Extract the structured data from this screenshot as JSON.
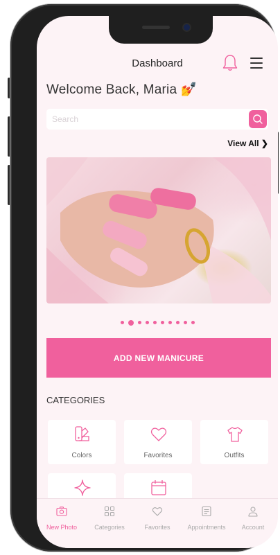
{
  "header": {
    "title": "Dashboard"
  },
  "welcome": {
    "text": "Welcome Back, Maria",
    "emoji": "💅"
  },
  "search": {
    "placeholder": "Search"
  },
  "featured": {
    "view_all": "View All ❯",
    "slide_count": 10,
    "active_slide": 2
  },
  "actions": {
    "add_manicure": "ADD NEW MANICURE"
  },
  "categories": {
    "title": "CATEGORIES",
    "items": [
      {
        "label": "Colors",
        "icon": "palette-icon"
      },
      {
        "label": "Favorites",
        "icon": "heart-icon"
      },
      {
        "label": "Outfits",
        "icon": "tshirt-icon"
      },
      {
        "label": "",
        "icon": "sparkle-icon"
      },
      {
        "label": "",
        "icon": "calendar-icon"
      }
    ]
  },
  "tabbar": {
    "items": [
      {
        "label": "New Photo",
        "icon": "camera-icon",
        "active": true
      },
      {
        "label": "Categories",
        "icon": "grid-icon",
        "active": false
      },
      {
        "label": "Favorites",
        "icon": "heart-icon",
        "active": false
      },
      {
        "label": "Appointments",
        "icon": "list-icon",
        "active": false
      },
      {
        "label": "Account",
        "icon": "user-icon",
        "active": false
      }
    ]
  },
  "colors": {
    "accent": "#f0609d",
    "background": "#fdf3f6"
  }
}
